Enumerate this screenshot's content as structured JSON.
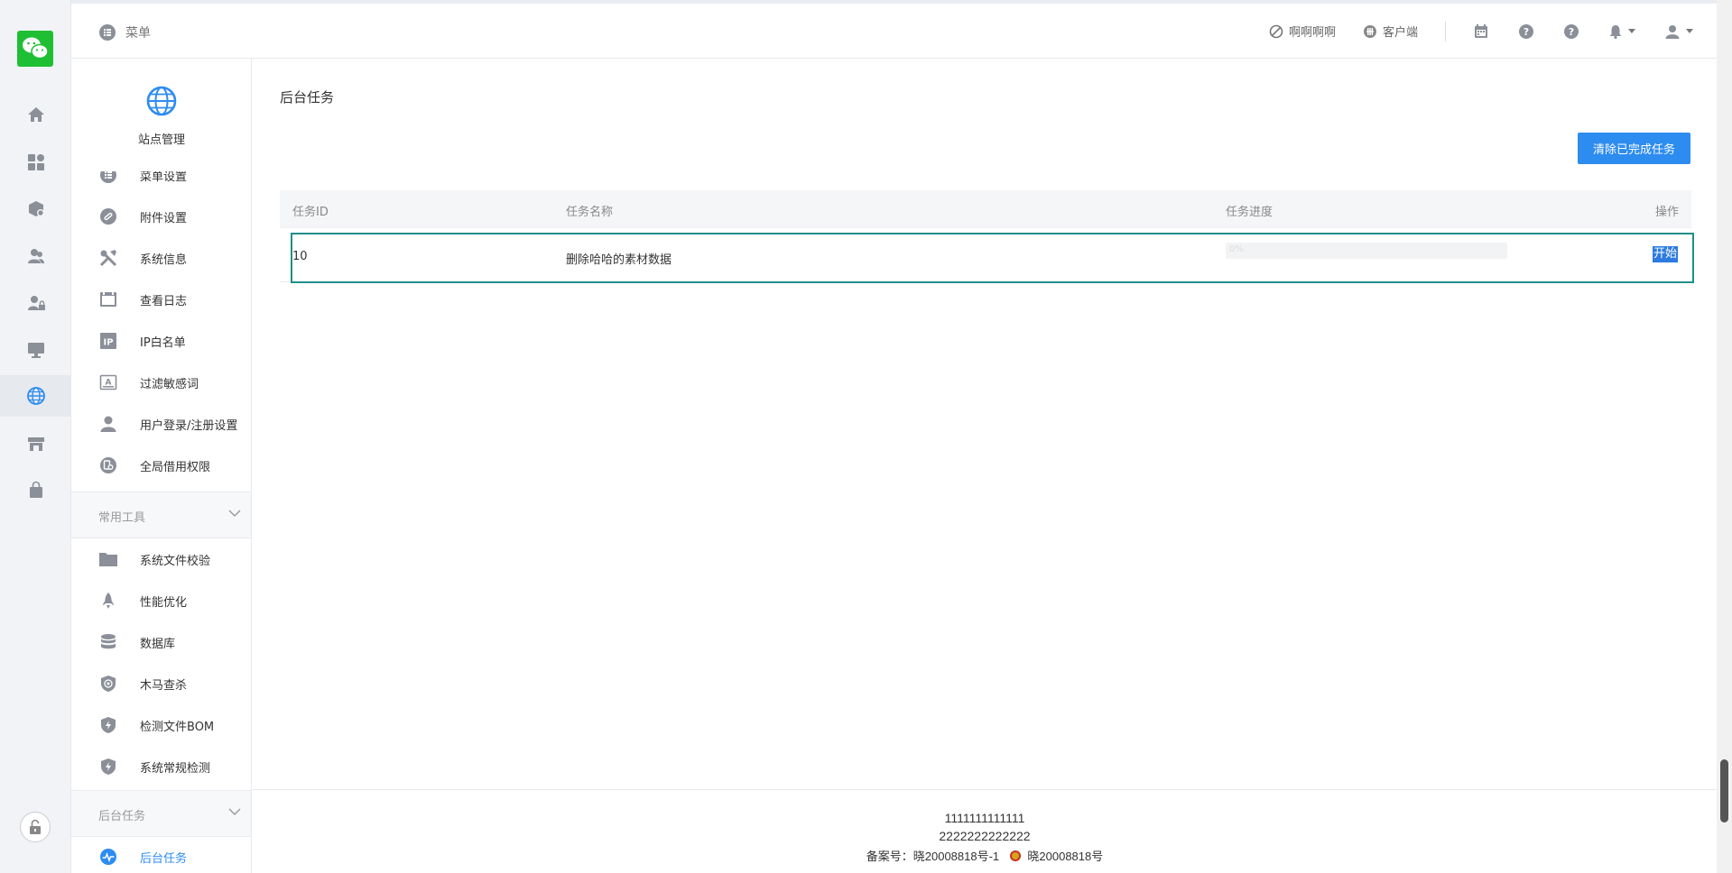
{
  "header": {
    "menu_label": "菜单",
    "link1": "啊啊啊啊",
    "link2": "客户端"
  },
  "sidebar": {
    "site_title": "站点管理",
    "items": [
      {
        "label": "菜单设置",
        "icon": "list-icon"
      },
      {
        "label": "附件设置",
        "icon": "link-icon"
      },
      {
        "label": "系统信息",
        "icon": "tools-icon"
      },
      {
        "label": "查看日志",
        "icon": "log-icon"
      },
      {
        "label": "IP白名单",
        "icon": "ip-icon"
      },
      {
        "label": "过滤敏感词",
        "icon": "filter-icon"
      },
      {
        "label": "用户登录/注册设置",
        "icon": "user-icon"
      },
      {
        "label": "全局借用权限",
        "icon": "permission-icon"
      }
    ],
    "group_tools": "常用工具",
    "tools": [
      {
        "label": "系统文件校验",
        "icon": "folder-icon"
      },
      {
        "label": "性能优化",
        "icon": "rocket-icon"
      },
      {
        "label": "数据库",
        "icon": "database-icon"
      },
      {
        "label": "木马查杀",
        "icon": "shield-scan-icon"
      },
      {
        "label": "检测文件BOM",
        "icon": "shield-bolt-icon"
      },
      {
        "label": "系统常规检测",
        "icon": "shield-bolt-icon"
      }
    ],
    "group_tasks": "后台任务",
    "tasks": [
      {
        "label": "后台任务",
        "icon": "pulse-icon"
      }
    ]
  },
  "main": {
    "title": "后台任务",
    "clear_button": "清除已完成任务",
    "columns": [
      "任务ID",
      "任务名称",
      "任务进度",
      "操作"
    ],
    "rows": [
      {
        "id": "10",
        "name": "删除哈哈的素材数据",
        "progress_text": "0%",
        "progress": 0,
        "action": "开始"
      }
    ]
  },
  "footer": {
    "line1": "1111111111111",
    "line2": "2222222222222",
    "icp": "备案号：晓20008818号-1",
    "police": "晓20008818号"
  },
  "colors": {
    "accent": "#2d8cf0",
    "highlight": "#1f8f8a",
    "logo": "#1fbf33"
  }
}
